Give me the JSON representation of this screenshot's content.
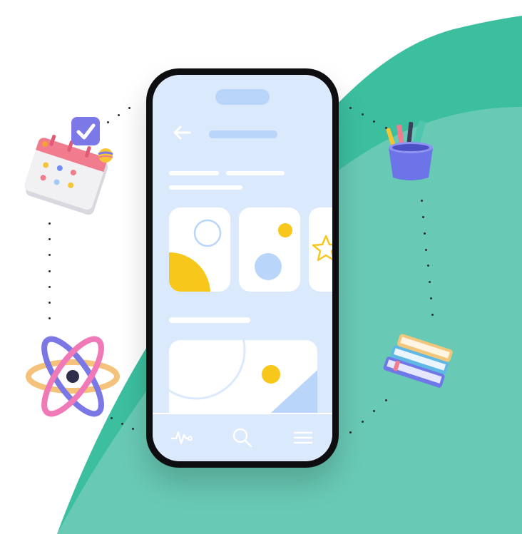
{
  "colors": {
    "accent_green": "#3cbf9f",
    "accent_green_light": "#70cbb8",
    "screen_bg": "#dbe9fc",
    "placeholder_blue": "#b9d5fa",
    "accent_yellow": "#f8c71c"
  },
  "icons": {
    "back": "arrow-left-icon",
    "activity": "activity-pulse-icon",
    "search": "search-icon",
    "menu": "hamburger-menu-icon"
  },
  "decorations": [
    "calendar-checkmark",
    "pencil-cup",
    "atom",
    "book-stack"
  ]
}
